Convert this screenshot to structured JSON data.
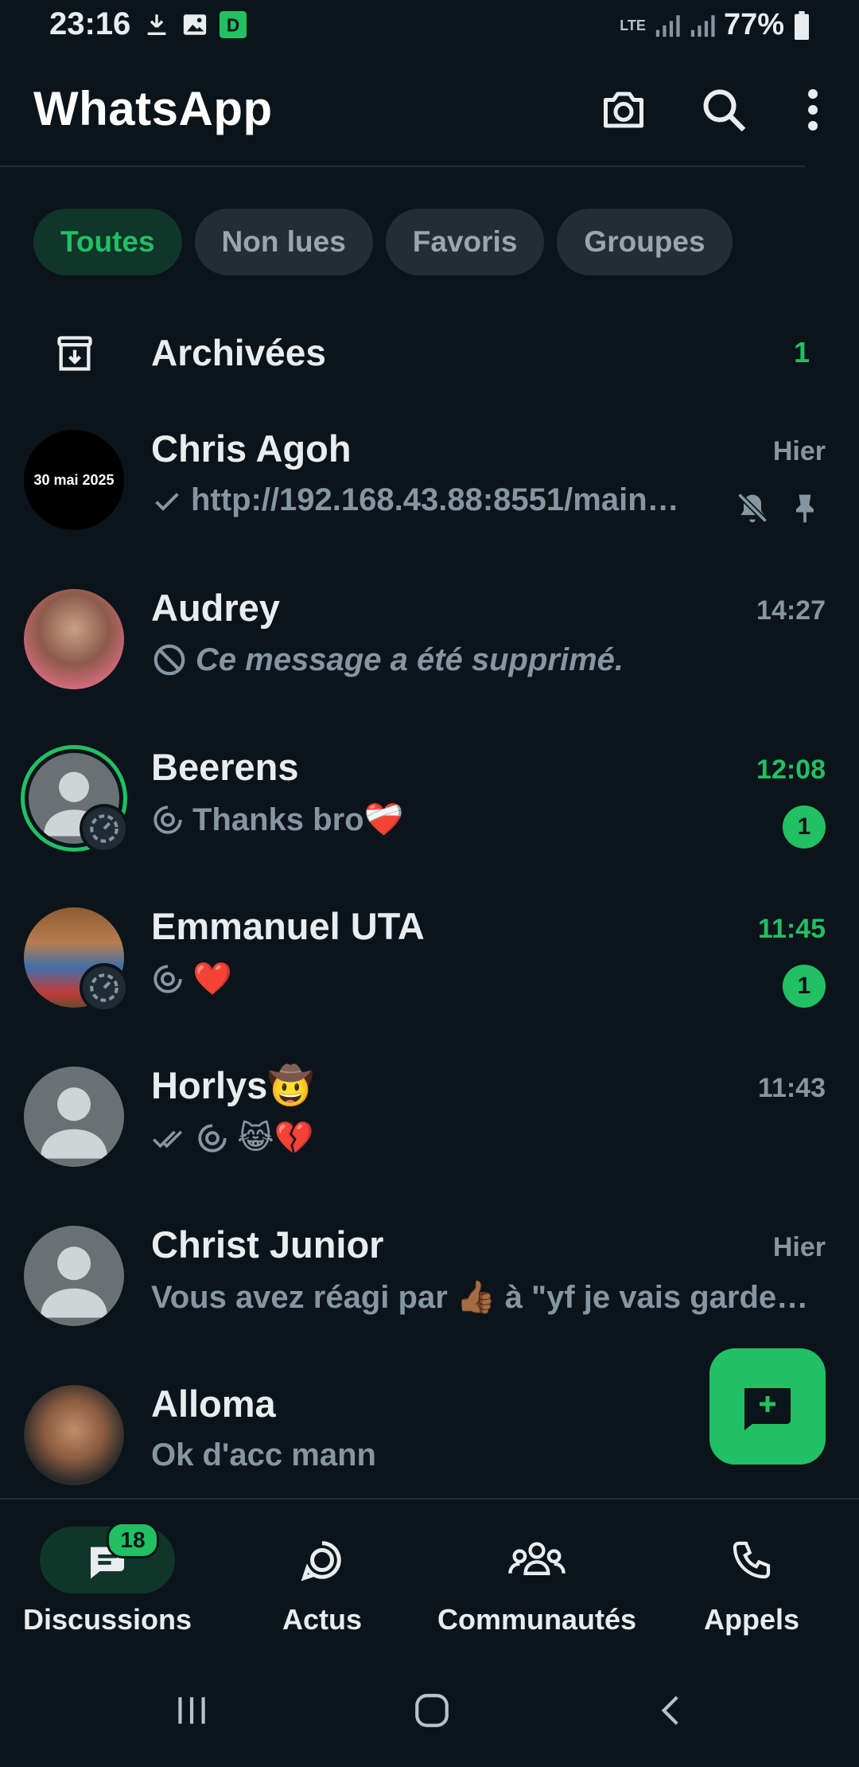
{
  "status_bar": {
    "time": "23:16",
    "network": "LTE",
    "battery": "77%",
    "icons": [
      "download-icon",
      "gallery-icon",
      "app-d-icon",
      "signal-icon",
      "signal-icon",
      "battery-icon"
    ]
  },
  "header": {
    "title": "WhatsApp",
    "icons": [
      "camera-icon",
      "search-icon",
      "more-vert-icon"
    ]
  },
  "filters": [
    {
      "label": "Toutes",
      "active": true
    },
    {
      "label": "Non lues",
      "active": false
    },
    {
      "label": "Favoris",
      "active": false
    },
    {
      "label": "Groupes",
      "active": false
    }
  ],
  "archived": {
    "label": "Archivées",
    "count": "1"
  },
  "chats": [
    {
      "name": "Chris Agoh",
      "time": "Hier",
      "preview": "http://192.168.43.88:8551/main…",
      "avatar_text": "30 mai 2025",
      "icons": [
        "single-check-icon",
        "mute-bell-icon",
        "pin-icon"
      ]
    },
    {
      "name": "Audrey",
      "time": "14:27",
      "preview": "Ce message a été supprimé.",
      "icons": [
        "deleted-icon"
      ]
    },
    {
      "name": "Beerens",
      "time": "12:08",
      "preview": "Thanks bro❤️‍🩹",
      "unread": "1",
      "icons": [
        "status-reply-icon"
      ]
    },
    {
      "name": "Emmanuel UTA",
      "time": "11:45",
      "preview": "❤️",
      "unread": "1",
      "icons": [
        "status-reply-icon"
      ]
    },
    {
      "name": "Horlys🤠",
      "time": "11:43",
      "preview": "😹💔",
      "icons": [
        "double-check-icon",
        "status-reply-icon"
      ]
    },
    {
      "name": "Christ Junior",
      "time": "Hier",
      "preview": "Vous avez réagi par 👍🏾 à \"yf je vais garde…"
    },
    {
      "name": "Alloma",
      "time": "",
      "preview": "Ok d'acc mann"
    }
  ],
  "fab": {
    "icon": "new-chat-icon"
  },
  "bottom_nav": [
    {
      "label": "Discussions",
      "icon": "chats-icon",
      "badge": "18",
      "active": true
    },
    {
      "label": "Actus",
      "icon": "updates-icon"
    },
    {
      "label": "Communautés",
      "icon": "communities-icon"
    },
    {
      "label": "Appels",
      "icon": "calls-icon"
    }
  ],
  "colors": {
    "background": "#0b141a",
    "accent": "#21c063",
    "chip_active_bg": "#103529",
    "chip_bg": "#232d34",
    "muted_text": "#8696a0"
  }
}
